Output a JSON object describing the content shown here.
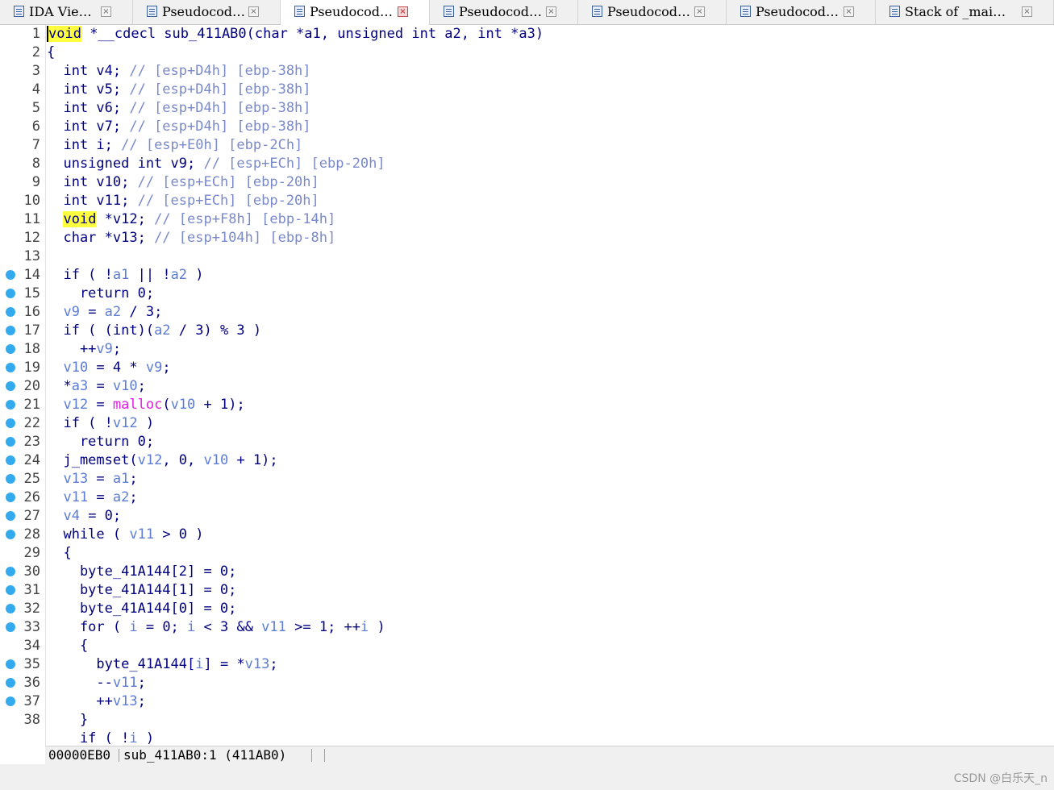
{
  "tabs": [
    {
      "label": "IDA Vie…",
      "icon": "disassembly-icon",
      "active": false
    },
    {
      "label": "Pseudocod…",
      "icon": "pseudocode-icon",
      "active": false
    },
    {
      "label": "Pseudocod…",
      "icon": "pseudocode-icon",
      "active": true
    },
    {
      "label": "Pseudocod…",
      "icon": "pseudocode-icon",
      "active": false
    },
    {
      "label": "Pseudocod…",
      "icon": "pseudocode-icon",
      "active": false
    },
    {
      "label": "Pseudocod…",
      "icon": "pseudocode-icon",
      "active": false
    },
    {
      "label": "Stack of _mai…",
      "icon": "stack-icon",
      "active": false
    }
  ],
  "tab_close_glyph": "×",
  "code": [
    {
      "n": "1",
      "bp": false,
      "tokens": [
        [
          "hl",
          "void"
        ],
        [
          "pl",
          " *__cdecl sub_411AB0(char *a1, unsigned int a2, int *a3)"
        ]
      ]
    },
    {
      "n": "2",
      "bp": false,
      "tokens": [
        [
          "pl",
          "{"
        ]
      ]
    },
    {
      "n": "3",
      "bp": false,
      "tokens": [
        [
          "pl",
          "  int v4; "
        ],
        [
          "cmt",
          "// [esp+D4h] [ebp-38h]"
        ]
      ]
    },
    {
      "n": "4",
      "bp": false,
      "tokens": [
        [
          "pl",
          "  int v5; "
        ],
        [
          "cmt",
          "// [esp+D4h] [ebp-38h]"
        ]
      ]
    },
    {
      "n": "5",
      "bp": false,
      "tokens": [
        [
          "pl",
          "  int v6; "
        ],
        [
          "cmt",
          "// [esp+D4h] [ebp-38h]"
        ]
      ]
    },
    {
      "n": "6",
      "bp": false,
      "tokens": [
        [
          "pl",
          "  int v7; "
        ],
        [
          "cmt",
          "// [esp+D4h] [ebp-38h]"
        ]
      ]
    },
    {
      "n": "7",
      "bp": false,
      "tokens": [
        [
          "kw",
          "  int i; "
        ],
        [
          "cmt",
          "// [esp+E0h] [ebp-2Ch]"
        ]
      ]
    },
    {
      "n": "8",
      "bp": false,
      "tokens": [
        [
          "kw",
          "  unsigned int v9; "
        ],
        [
          "cmt",
          "// [esp+ECh] [ebp-20h]"
        ]
      ]
    },
    {
      "n": "9",
      "bp": false,
      "tokens": [
        [
          "kw",
          "  int v10; "
        ],
        [
          "cmt",
          "// [esp+ECh] [ebp-20h]"
        ]
      ]
    },
    {
      "n": "10",
      "bp": false,
      "tokens": [
        [
          "kw",
          "  int v11; "
        ],
        [
          "cmt",
          "// [esp+ECh] [ebp-20h]"
        ]
      ]
    },
    {
      "n": "11",
      "bp": false,
      "tokens": [
        [
          "pl",
          "  "
        ],
        [
          "hl",
          "void"
        ],
        [
          "pl",
          " *v12; "
        ],
        [
          "cmt",
          "// [esp+F8h] [ebp-14h]"
        ]
      ]
    },
    {
      "n": "12",
      "bp": false,
      "tokens": [
        [
          "pl",
          "  char *v13; "
        ],
        [
          "cmt",
          "// [esp+104h] [ebp-8h]"
        ]
      ]
    },
    {
      "n": "13",
      "bp": false,
      "tokens": [
        [
          "pl",
          ""
        ]
      ]
    },
    {
      "n": "14",
      "bp": true,
      "tokens": [
        [
          "kw",
          "  if ( !"
        ],
        [
          "var",
          "a1"
        ],
        [
          "kw",
          " || !"
        ],
        [
          "var",
          "a2"
        ],
        [
          "kw",
          " )"
        ]
      ]
    },
    {
      "n": "15",
      "bp": true,
      "tokens": [
        [
          "kw",
          "    return 0;"
        ]
      ]
    },
    {
      "n": "16",
      "bp": true,
      "tokens": [
        [
          "var",
          "  v9"
        ],
        [
          "kw",
          " = "
        ],
        [
          "var",
          "a2"
        ],
        [
          "kw",
          " / 3;"
        ]
      ]
    },
    {
      "n": "17",
      "bp": true,
      "tokens": [
        [
          "kw",
          "  if ( (int)("
        ],
        [
          "var",
          "a2"
        ],
        [
          "kw",
          " / 3) % 3 )"
        ]
      ]
    },
    {
      "n": "18",
      "bp": true,
      "tokens": [
        [
          "kw",
          "    ++"
        ],
        [
          "var",
          "v9"
        ],
        [
          "kw",
          ";"
        ]
      ]
    },
    {
      "n": "19",
      "bp": true,
      "tokens": [
        [
          "var",
          "  v10"
        ],
        [
          "kw",
          " = 4 * "
        ],
        [
          "var",
          "v9"
        ],
        [
          "kw",
          ";"
        ]
      ]
    },
    {
      "n": "20",
      "bp": true,
      "tokens": [
        [
          "kw",
          "  *"
        ],
        [
          "var",
          "a3"
        ],
        [
          "kw",
          " = "
        ],
        [
          "var",
          "v10"
        ],
        [
          "kw",
          ";"
        ]
      ]
    },
    {
      "n": "21",
      "bp": true,
      "tokens": [
        [
          "var",
          "  v12"
        ],
        [
          "kw",
          " = "
        ],
        [
          "fn",
          "malloc"
        ],
        [
          "kw",
          "("
        ],
        [
          "var",
          "v10"
        ],
        [
          "kw",
          " + 1);"
        ]
      ]
    },
    {
      "n": "22",
      "bp": true,
      "tokens": [
        [
          "kw",
          "  if ( !"
        ],
        [
          "var",
          "v12"
        ],
        [
          "kw",
          " )"
        ]
      ]
    },
    {
      "n": "23",
      "bp": true,
      "tokens": [
        [
          "kw",
          "    return 0;"
        ]
      ]
    },
    {
      "n": "24",
      "bp": true,
      "tokens": [
        [
          "kw",
          "  j_memset("
        ],
        [
          "var",
          "v12"
        ],
        [
          "kw",
          ", 0, "
        ],
        [
          "var",
          "v10"
        ],
        [
          "kw",
          " + 1);"
        ]
      ]
    },
    {
      "n": "25",
      "bp": true,
      "tokens": [
        [
          "var",
          "  v13"
        ],
        [
          "kw",
          " = "
        ],
        [
          "var",
          "a1"
        ],
        [
          "kw",
          ";"
        ]
      ]
    },
    {
      "n": "26",
      "bp": true,
      "tokens": [
        [
          "var",
          "  v11"
        ],
        [
          "kw",
          " = "
        ],
        [
          "var",
          "a2"
        ],
        [
          "kw",
          ";"
        ]
      ]
    },
    {
      "n": "27",
      "bp": true,
      "tokens": [
        [
          "var",
          "  v4"
        ],
        [
          "kw",
          " = 0;"
        ]
      ]
    },
    {
      "n": "28",
      "bp": true,
      "tokens": [
        [
          "kw",
          "  while ( "
        ],
        [
          "var",
          "v11"
        ],
        [
          "kw",
          " > 0 )"
        ]
      ]
    },
    {
      "n": "29",
      "bp": false,
      "tokens": [
        [
          "kw",
          "  {"
        ]
      ]
    },
    {
      "n": "30",
      "bp": true,
      "tokens": [
        [
          "kw",
          "    byte_41A144[2] = 0;"
        ]
      ]
    },
    {
      "n": "31",
      "bp": true,
      "tokens": [
        [
          "kw",
          "    byte_41A144[1] = 0;"
        ]
      ]
    },
    {
      "n": "32",
      "bp": true,
      "tokens": [
        [
          "kw",
          "    byte_41A144[0] = 0;"
        ]
      ]
    },
    {
      "n": "33",
      "bp": true,
      "tokens": [
        [
          "kw",
          "    for ( "
        ],
        [
          "var",
          "i"
        ],
        [
          "kw",
          " = 0; "
        ],
        [
          "var",
          "i"
        ],
        [
          "kw",
          " < 3 && "
        ],
        [
          "var",
          "v11"
        ],
        [
          "kw",
          " >= 1; ++"
        ],
        [
          "var",
          "i"
        ],
        [
          "kw",
          " )"
        ]
      ]
    },
    {
      "n": "34",
      "bp": false,
      "tokens": [
        [
          "kw",
          "    {"
        ]
      ]
    },
    {
      "n": "35",
      "bp": true,
      "tokens": [
        [
          "kw",
          "      byte_41A144["
        ],
        [
          "var",
          "i"
        ],
        [
          "kw",
          "] = *"
        ],
        [
          "var",
          "v13"
        ],
        [
          "kw",
          ";"
        ]
      ]
    },
    {
      "n": "36",
      "bp": true,
      "tokens": [
        [
          "kw",
          "      --"
        ],
        [
          "var",
          "v11"
        ],
        [
          "kw",
          ";"
        ]
      ]
    },
    {
      "n": "37",
      "bp": true,
      "tokens": [
        [
          "kw",
          "      ++"
        ],
        [
          "var",
          "v13"
        ],
        [
          "kw",
          ";"
        ]
      ]
    },
    {
      "n": "38",
      "bp": false,
      "tokens": [
        [
          "kw",
          "    }"
        ]
      ]
    },
    {
      "n": "",
      "bp": false,
      "tokens": [
        [
          "kw",
          "    if ( !"
        ],
        [
          "var",
          "i"
        ],
        [
          "kw",
          " )"
        ]
      ]
    }
  ],
  "status": {
    "offset": "00000EB0",
    "location": "sub_411AB0:1 (411AB0)"
  },
  "watermark": "CSDN @白乐天_n",
  "colors": {
    "keyword": "#000080",
    "variable": "#5c7cd6",
    "comment": "#7a89c9",
    "function": "#e01ee0",
    "highlight": "#ffff40",
    "breakpoint": "#33aaee"
  }
}
